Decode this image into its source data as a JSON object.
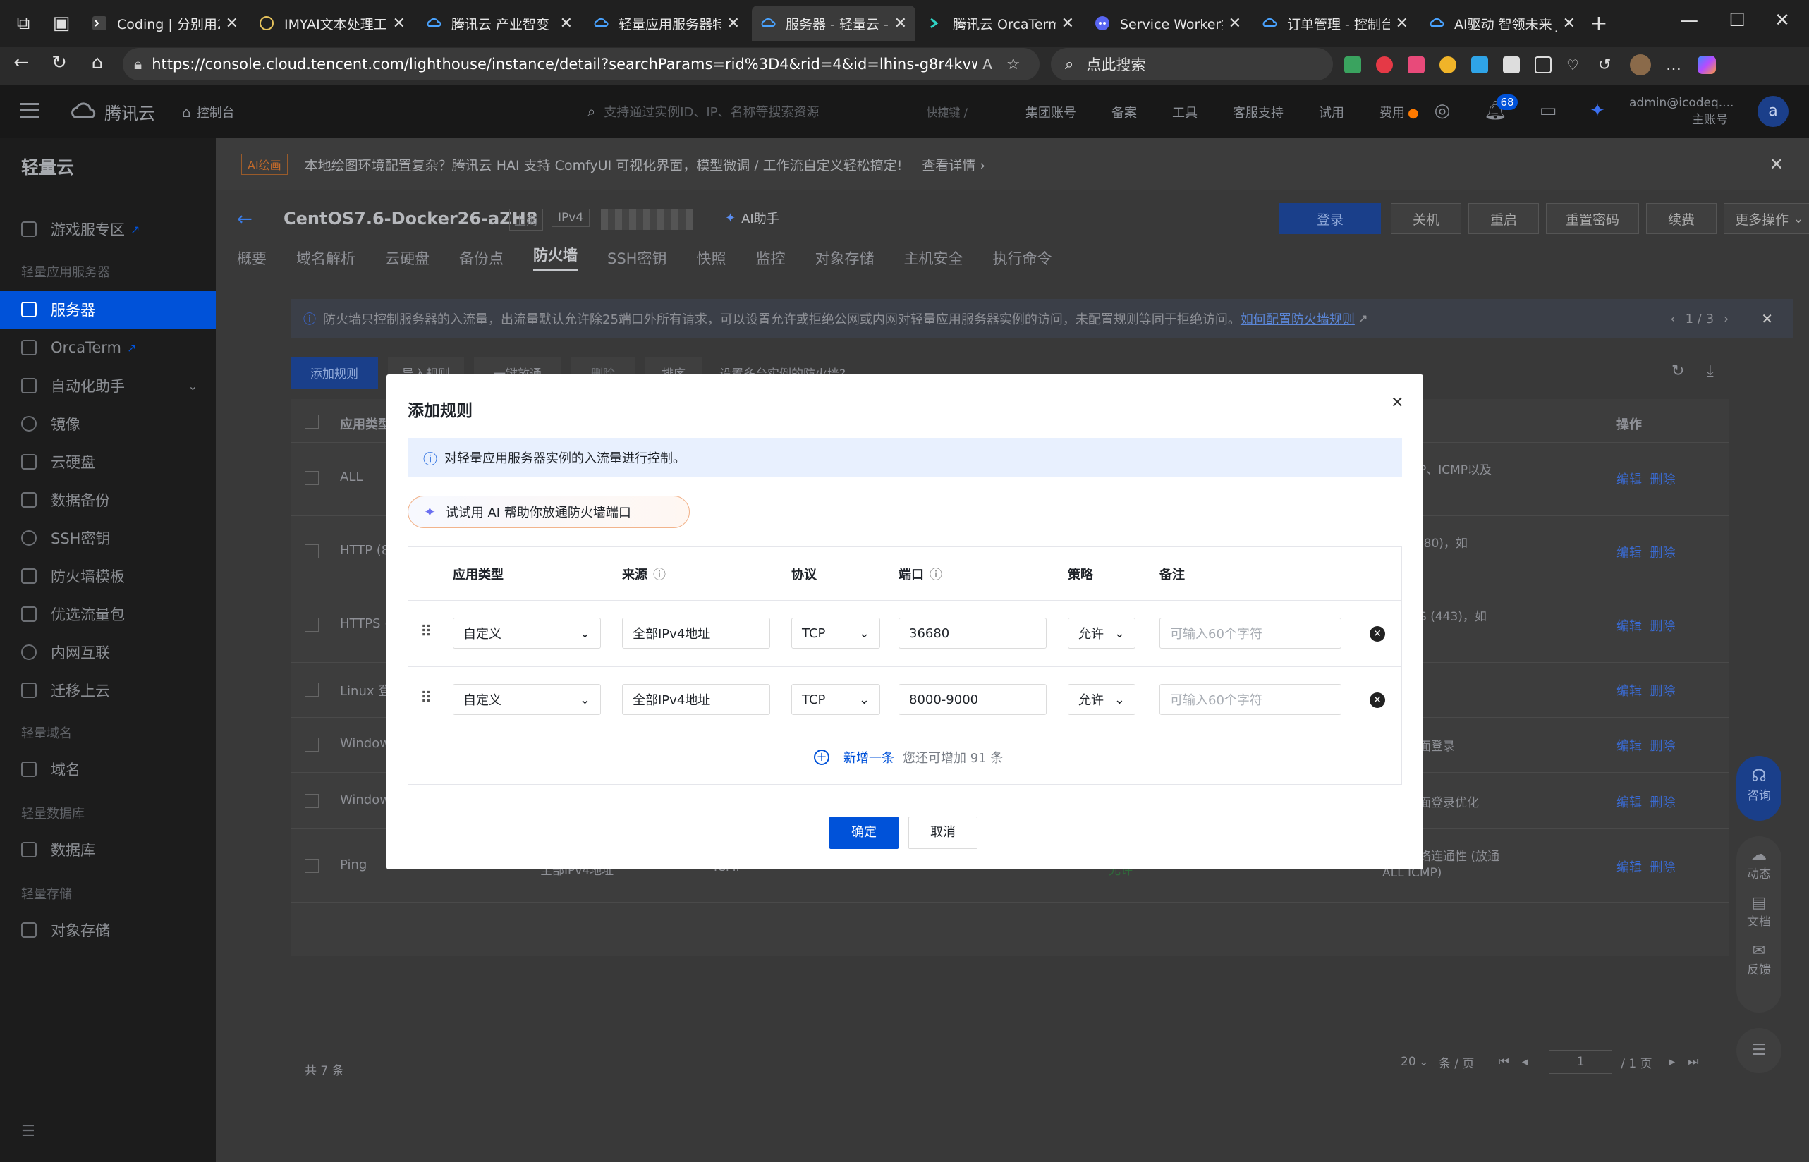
{
  "browser": {
    "tabs": [
      {
        "title": "Coding | 分别用2"
      },
      {
        "title": "IMYAI文本处理工具"
      },
      {
        "title": "腾讯云 产业智变"
      },
      {
        "title": "轻量应用服务器特"
      },
      {
        "title": "服务器 - 轻量云 -"
      },
      {
        "title": "腾讯云 OrcaTerm"
      },
      {
        "title": "Service Worker拦截"
      },
      {
        "title": "订单管理 - 控制台"
      },
      {
        "title": "AI驱动 智领未来 J"
      }
    ],
    "url": "https://console.cloud.tencent.com/lighthouse/instance/detail?searchParams=rid%3D4&rid=4&id=lhins-g8r4kvwm&tab=fi...",
    "search_placeholder": "点此搜索"
  },
  "topnav": {
    "brand": "腾讯云",
    "console": "控制台",
    "search_placeholder": "支持通过实例ID、IP、名称等搜索资源",
    "shortcut": "快捷键 /",
    "links": [
      "集团账号",
      "备案",
      "工具",
      "客服支持",
      "试用",
      "费用"
    ],
    "badge": "68",
    "account": "admin@icodeq....",
    "account_role": "主账号",
    "avatar": "a"
  },
  "sidebar": {
    "title": "轻量云",
    "items": [
      {
        "label": "游戏服专区"
      },
      {
        "group": "轻量应用服务器"
      },
      {
        "label": "服务器"
      },
      {
        "label": "OrcaTerm"
      },
      {
        "label": "自动化助手"
      },
      {
        "label": "镜像"
      },
      {
        "label": "云硬盘"
      },
      {
        "label": "数据备份"
      },
      {
        "label": "SSH密钥"
      },
      {
        "label": "防火墙模板"
      },
      {
        "label": "优选流量包"
      },
      {
        "label": "内网互联"
      },
      {
        "label": "迁移上云"
      },
      {
        "group": "轻量域名"
      },
      {
        "label": "域名"
      },
      {
        "group": "轻量数据库"
      },
      {
        "label": "数据库"
      },
      {
        "group": "轻量存储"
      },
      {
        "label": "对象存储"
      }
    ]
  },
  "banner": {
    "tag": "AI绘画",
    "text": "本地绘图环境配置复杂？腾讯云 HAI 支持 ComfyUI 可视化界面，模型微调 / 工作流自定义轻松搞定!",
    "link": "查看详情"
  },
  "instance": {
    "name": "CentOS7.6-Docker26-aZH8",
    "region": "上海",
    "ip_type": "IPv4",
    "ai": "AI助手",
    "actions": [
      "登录",
      "关机",
      "重启",
      "重置密码",
      "续费",
      "更多操作"
    ],
    "tabs": [
      "概要",
      "域名解析",
      "云硬盘",
      "备份点",
      "防火墙",
      "SSH密钥",
      "快照",
      "监控",
      "对象存储",
      "主机安全",
      "执行命令"
    ],
    "active_tab": "防火墙"
  },
  "firewall": {
    "notice": "防火墙只控制服务器的入流量，出流量默认允许除25端口外所有请求，可以设置允许或拒绝公网或内网对轻量应用服务器实例的访问，未配置规则等同于拒绝访问。",
    "notice_link": "如何配置防火墙规则",
    "pager": "1 / 3",
    "toolbar": [
      "添加规则",
      "导入规则",
      "一键放通",
      "删除",
      "排序",
      "设置多台实例的防火墙?"
    ],
    "header_type": "应用类型",
    "header_ops": "操作",
    "rows": [
      {
        "type": "ALL",
        "remark": "P、ICMP以及"
      },
      {
        "type": "HTTP (8",
        "remark": "(80)，如"
      },
      {
        "type": "HTTPS (",
        "remark": "S (443)，如"
      },
      {
        "type": "Linux 登",
        "remark": ""
      },
      {
        "type": "Windows",
        "remark": "面登录"
      },
      {
        "type": "Windows",
        "remark": "面登录优化"
      },
      {
        "type": "Ping",
        "source": "全部IPv4地址",
        "proto": "ICMP",
        "port": "ALL",
        "policy": "允许",
        "remark": "络连通性 (放通",
        "remark2": "ALL ICMP)"
      }
    ],
    "edit": "编辑",
    "delete": "删除",
    "total": "共 7 条",
    "page_size": "20",
    "per_page": "条 / 页",
    "page": "1",
    "page_total": "/ 1 页"
  },
  "float": {
    "consult": "咨询",
    "dynamic": "动态",
    "docs": "文档",
    "feedback": "反馈"
  },
  "modal": {
    "title": "添加规则",
    "info": "对轻量应用服务器实例的入流量进行控制。",
    "ai_button": "试试用 AI 帮助你放通防火墙端口",
    "headers": {
      "type": "应用类型",
      "source": "来源",
      "protocol": "协议",
      "port": "端口",
      "policy": "策略",
      "remark": "备注"
    },
    "rows": [
      {
        "type": "自定义",
        "source": "全部IPv4地址",
        "protocol": "TCP",
        "port": "36680",
        "policy": "允许",
        "remark_placeholder": "可输入60个字符"
      },
      {
        "type": "自定义",
        "source": "全部IPv4地址",
        "protocol": "TCP",
        "port": "8000-9000",
        "policy": "允许",
        "remark_placeholder": "可输入60个字符"
      }
    ],
    "add_label": "新增一条",
    "add_hint": "您还可增加 91 条",
    "confirm": "确定",
    "cancel": "取消"
  }
}
